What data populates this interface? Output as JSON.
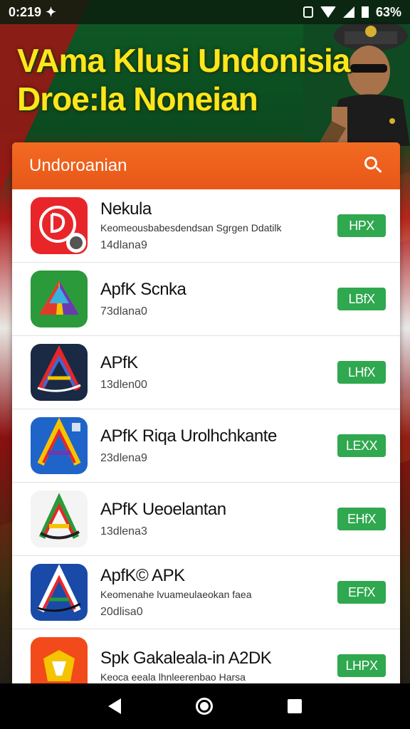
{
  "status_bar": {
    "time": "0:219",
    "battery": "63%"
  },
  "banner": {
    "line1": "VAma Klusi Undonisia",
    "line2": "Droe:la Noneian"
  },
  "header": {
    "title": "Undoroanian"
  },
  "apps": [
    {
      "name": "Nekula",
      "desc": "Keomeousbabesdendsan Sgrgen Ddatilk",
      "meta": "14dlana9",
      "button": "HPX"
    },
    {
      "name": "ApfK Scnka",
      "desc": "",
      "meta": "73dlana0",
      "button": "LBfX"
    },
    {
      "name": "APfK",
      "desc": "",
      "meta": "13dlen00",
      "button": "LHfX"
    },
    {
      "name": "APfK Riqa Urolhchkante",
      "desc": "",
      "meta": "23dlena9",
      "button": "LEXX"
    },
    {
      "name": "APfK Ueoelantan",
      "desc": "",
      "meta": "13dlena3",
      "button": "EHfX"
    },
    {
      "name": "ApfK© APK",
      "desc": "Keomenahe lvuameulaeokan faea",
      "meta": "20dlisa0",
      "button": "EFfX"
    },
    {
      "name": "Spk Gakaleala-in A2DK",
      "desc": "Keoca eeala lhnleerenbao Harsa",
      "meta": "",
      "button": "LHPX"
    }
  ],
  "colors": {
    "header": "#f26a22",
    "button": "#2fa84f",
    "banner_text": "#ffe61a"
  }
}
